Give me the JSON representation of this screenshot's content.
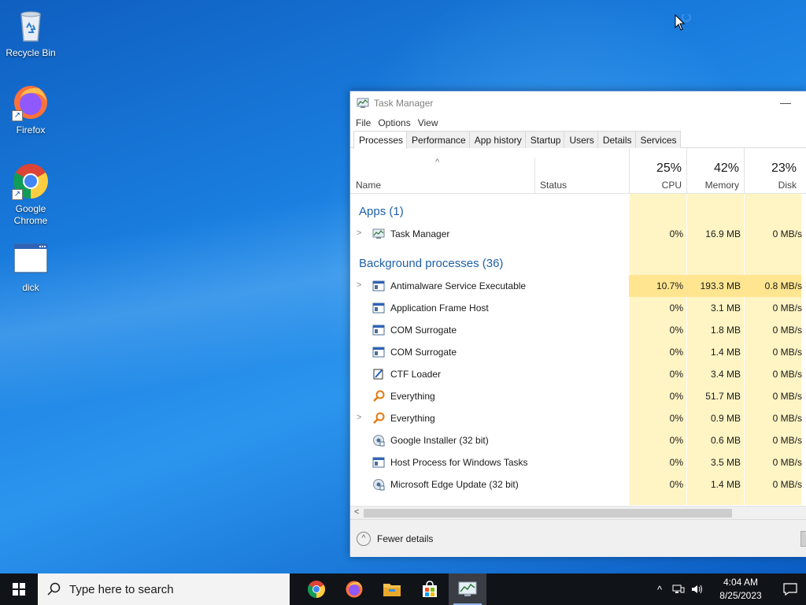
{
  "desktop": {
    "icons": [
      {
        "label": "Recycle Bin"
      },
      {
        "label": "Firefox"
      },
      {
        "label": "Google\nChrome"
      },
      {
        "label": "dick"
      }
    ]
  },
  "taskmanager": {
    "title": "Task Manager",
    "minimize_glyph": "—",
    "menu": [
      "File",
      "Options",
      "View"
    ],
    "tabs": [
      "Processes",
      "Performance",
      "App history",
      "Startup",
      "Users",
      "Details",
      "Services"
    ],
    "active_tab": "Processes",
    "header": {
      "name": "Name",
      "status": "Status",
      "cpu_pct": "25%",
      "cpu": "CPU",
      "mem_pct": "42%",
      "mem": "Memory",
      "disk_pct": "23%",
      "disk": "Disk"
    },
    "apps_section": "Apps (1)",
    "bg_section": "Background processes (36)",
    "apps": [
      {
        "name": "Task Manager",
        "cpu": "0%",
        "mem": "16.9 MB",
        "disk": "0 MB/s",
        "icon": "taskmgr-icon",
        "expandable": true
      }
    ],
    "processes": [
      {
        "name": "Antimalware Service Executable",
        "cpu": "10.7%",
        "mem": "193.3 MB",
        "disk": "0.8 MB/s",
        "icon": "service-icon",
        "expandable": true,
        "hot": true
      },
      {
        "name": "Application Frame Host",
        "cpu": "0%",
        "mem": "3.1 MB",
        "disk": "0 MB/s",
        "icon": "service-icon"
      },
      {
        "name": "COM Surrogate",
        "cpu": "0%",
        "mem": "1.8 MB",
        "disk": "0 MB/s",
        "icon": "service-icon"
      },
      {
        "name": "COM Surrogate",
        "cpu": "0%",
        "mem": "1.4 MB",
        "disk": "0 MB/s",
        "icon": "service-icon"
      },
      {
        "name": "CTF Loader",
        "cpu": "0%",
        "mem": "3.4 MB",
        "disk": "0 MB/s",
        "icon": "ctf-icon"
      },
      {
        "name": "Everything",
        "cpu": "0%",
        "mem": "51.7 MB",
        "disk": "0 MB/s",
        "icon": "everything-icon"
      },
      {
        "name": "Everything",
        "cpu": "0%",
        "mem": "0.9 MB",
        "disk": "0 MB/s",
        "icon": "everything-icon",
        "expandable": true
      },
      {
        "name": "Google Installer (32 bit)",
        "cpu": "0%",
        "mem": "0.6 MB",
        "disk": "0 MB/s",
        "icon": "installer-icon"
      },
      {
        "name": "Host Process for Windows Tasks",
        "cpu": "0%",
        "mem": "3.5 MB",
        "disk": "0 MB/s",
        "icon": "service-icon"
      },
      {
        "name": "Microsoft Edge Update (32 bit)",
        "cpu": "0%",
        "mem": "1.4 MB",
        "disk": "0 MB/s",
        "icon": "installer-icon"
      }
    ],
    "fewer_details": "Fewer details"
  },
  "taskbar": {
    "search_placeholder": "Type here to search",
    "apps": [
      "chrome-icon",
      "firefox-icon",
      "file-explorer-icon",
      "store-icon",
      "task-manager-icon"
    ],
    "time": "4:04 AM",
    "date": "8/25/2023"
  }
}
